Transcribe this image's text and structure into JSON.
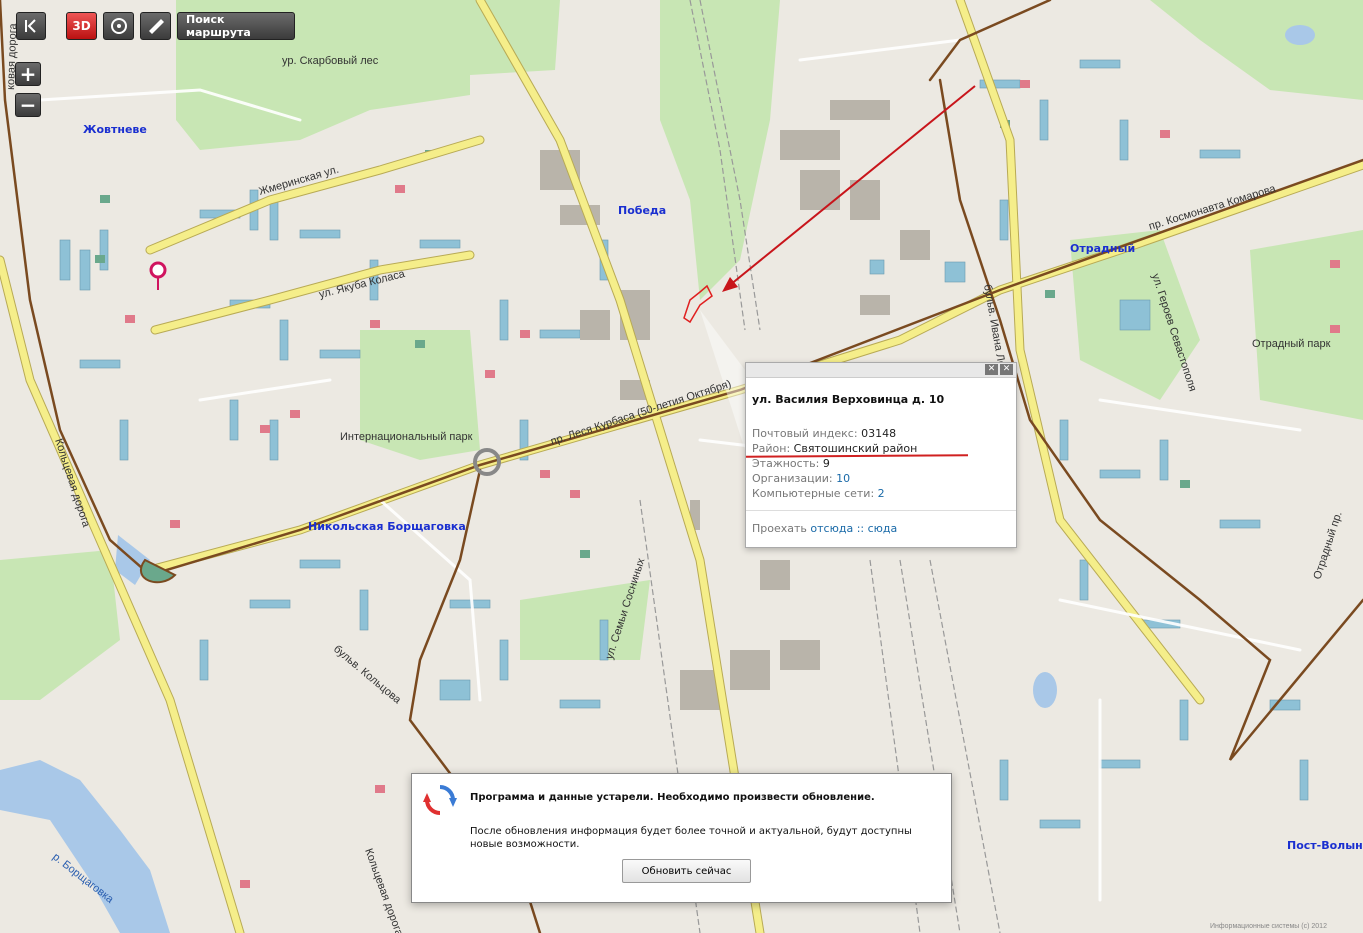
{
  "toolbar": {
    "back_label": "K",
    "threed_label": "3D",
    "route_label": "Поиск маршрута"
  },
  "zoom": {
    "in_label": "+",
    "out_label": "−"
  },
  "map_labels": {
    "streets": [
      "ур. Скарбовый лес",
      "Жмеринская ул.",
      "ул. Якуба Коласа",
      "пр. Леся Курбаса (50-летия Октября)",
      "Интернациональный парк",
      "Кольцевая дорога",
      "бульв. Кольцова",
      "ул. Семьи Сосниных",
      "бульв. Ивана Лепсе",
      "пр. Космонавта Комарова",
      "ул. Героев Севастополя",
      "Отрадный парк",
      "Кольцевая дорога",
      "Отрадный пр.",
      "ковая дорога",
      "Информационные системы (с) 2012"
    ],
    "places": [
      "Жовтневе",
      "Победа",
      "Никольская Борщаговка",
      "Отрадный",
      "Пост-Волынский"
    ],
    "water": [
      "р. Борщаговка"
    ]
  },
  "popup": {
    "address": "ул. Василия Верховинца д. 10",
    "postal_label": "Почтовый индекс:",
    "postal_value": "03148",
    "district_label": "Район:",
    "district_value": "Святошинский район",
    "floors_label": "Этажность:",
    "floors_value": "9",
    "orgs_label": "Организации:",
    "orgs_value": "10",
    "networks_label": "Компьютерные сети:",
    "networks_value": "2",
    "route_label": "Проехать",
    "route_from": "отсюда",
    "route_sep": "::",
    "route_to": "сюда"
  },
  "update_dialog": {
    "title": "Программа и данные устарели. Необходимо произвести обновление.",
    "body": "После обновления информация будет более точной и актуальной, будут доступны новые возможности.",
    "button": "Обновить сейчас"
  },
  "colors": {
    "map_bg": "#ece9e2",
    "park": "#c8e6b4",
    "water": "#a9c8e8",
    "road_main": "#f5ee8a",
    "road_outline": "#b8aa55",
    "ring_road": "#7a4a20",
    "building_blue": "#8ec1d6",
    "building_red": "#e07a8a",
    "building_green": "#6aa88c",
    "arrow": "#c8151b",
    "underline": "#d02020"
  }
}
